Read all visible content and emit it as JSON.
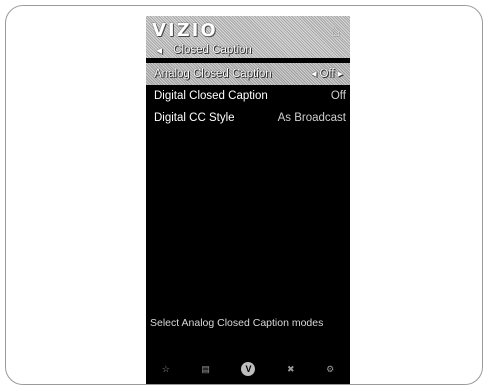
{
  "header": {
    "logo": "VIZIO",
    "home_icon": "home-icon"
  },
  "breadcrumb": {
    "back_icon": "back-arrow-icon",
    "title": "Closed Caption"
  },
  "menu": {
    "items": [
      {
        "label": "Analog Closed Caption",
        "value": "Off",
        "selected": true
      },
      {
        "label": "Digital Closed Caption",
        "value": "Off",
        "selected": false
      },
      {
        "label": "Digital CC Style",
        "value": "As Broadcast",
        "selected": false
      }
    ]
  },
  "hint": "Select Analog Closed Caption modes",
  "bottom_bar": {
    "icons": [
      "star-icon",
      "widescreen-icon",
      "vizio-v-icon",
      "close-icon",
      "gear-icon"
    ]
  }
}
